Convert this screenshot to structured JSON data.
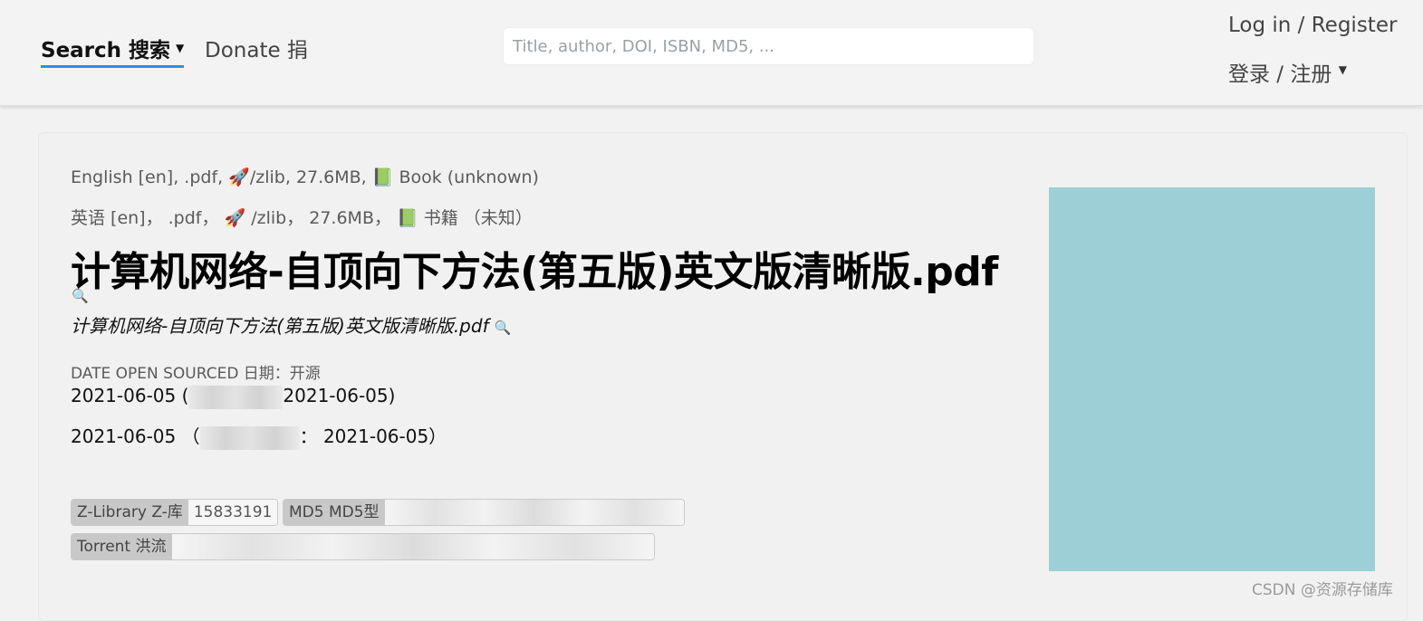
{
  "header": {
    "search_label": "Search  搜索",
    "donate_label": "Donate 捐",
    "search_placeholder": "Title, author, DOI, ISBN, MD5, ...",
    "login_line1": "Log in / Register",
    "login_line2": "登录 / 注册"
  },
  "record": {
    "meta_en": "English [en], .pdf, 🚀/zlib, 27.6MB, 📗 Book (unknown)",
    "meta_zh": "英语 [en]， .pdf， 🚀 /zlib， 27.6MB， 📗 书籍 （未知）",
    "title": "计算机网络-自顶向下方法(第五版)英文版清晰版.pdf",
    "subtitle": "计算机网络-自顶向下方法(第五版)英文版清晰版.pdf",
    "date_label": "DATE OPEN SOURCED 日期：开源",
    "date_line1_start": "2021-06-05 (",
    "date_line1_end": "2021-06-05)",
    "date_line2_start": "2021-06-05 （",
    "date_line2_end": "： 2021-06-05）",
    "tags": [
      {
        "key": "Z-Library Z-库",
        "value": "15833191"
      },
      {
        "key": "MD5 MD5型",
        "value": ""
      },
      {
        "key": "Torrent 洪流",
        "value": ""
      }
    ],
    "cover_color": "#9ccfd6"
  },
  "icons": {
    "magnifier": "🔍"
  },
  "watermark": "CSDN @资源存储库",
  "colors": {
    "accent": "#2f8ded",
    "cover": "#9ccfd6"
  }
}
